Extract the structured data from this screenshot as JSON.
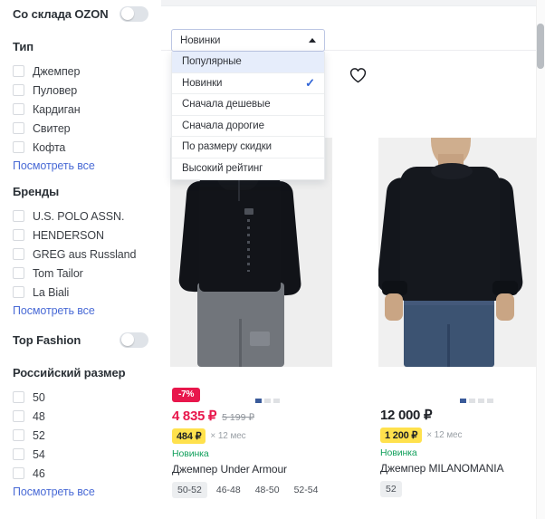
{
  "sidebar": {
    "ozon_warehouse": {
      "label": "Со склада OZON",
      "toggle_state": "off"
    },
    "type_group": {
      "heading": "Тип",
      "options": [
        "Джемпер",
        "Пуловер",
        "Кардиган",
        "Свитер",
        "Кофта"
      ],
      "see_all": "Посмотреть все"
    },
    "brands_group": {
      "heading": "Бренды",
      "options": [
        "U.S. POLO ASSN.",
        "HENDERSON",
        "GREG aus Russland",
        "Tom Tailor",
        "La Biali"
      ],
      "see_all": "Посмотреть все"
    },
    "top_fashion": {
      "label": "Top Fashion",
      "toggle_state": "off"
    },
    "size_group": {
      "heading": "Российский размер",
      "options": [
        "50",
        "48",
        "52",
        "54",
        "46"
      ],
      "see_all": "Посмотреть все"
    }
  },
  "sort": {
    "selected": "Новинки",
    "caret_icon": "caret-up-icon",
    "open": true,
    "options": [
      {
        "label": "Популярные",
        "checked": false,
        "hovered": true
      },
      {
        "label": "Новинки",
        "checked": true,
        "hovered": false
      },
      {
        "label": "Сначала дешевые",
        "checked": false,
        "hovered": false
      },
      {
        "label": "Сначала дорогие",
        "checked": false,
        "hovered": false
      },
      {
        "label": "По размеру скидки",
        "checked": false,
        "hovered": false
      },
      {
        "label": "Высокий рейтинг",
        "checked": false,
        "hovered": false
      }
    ],
    "check_glyph": "✓"
  },
  "favorite_icon": "heart-outline-icon",
  "products": [
    {
      "discount_badge": "-7%",
      "price_current": "4 835 ₽",
      "price_old": "5 199 ₽",
      "installment_amount": "484 ₽",
      "installment_note": "× 12 мес",
      "tag": "Новинка",
      "name": "Джемпер Under Armour",
      "sizes": [
        "50-52",
        "46-48",
        "48-50",
        "52-54"
      ],
      "selected_size": "50-52",
      "carousel_dots": 3,
      "carousel_active": 0
    },
    {
      "discount_badge": "",
      "price_current": "12 000 ₽",
      "price_old": "",
      "installment_amount": "1 200 ₽",
      "installment_note": "× 12 мес",
      "tag": "Новинка",
      "name": "Джемпер MILANOMANIA",
      "sizes": [
        "52"
      ],
      "selected_size": "52",
      "carousel_dots": 4,
      "carousel_active": 0
    }
  ],
  "colors": {
    "accent_price": "#e8174c",
    "link": "#4a6bd6",
    "new_tag": "#12a05c",
    "installment_bg": "#ffe14d",
    "menu_hover": "#e6edfb",
    "check": "#2f63d6"
  }
}
